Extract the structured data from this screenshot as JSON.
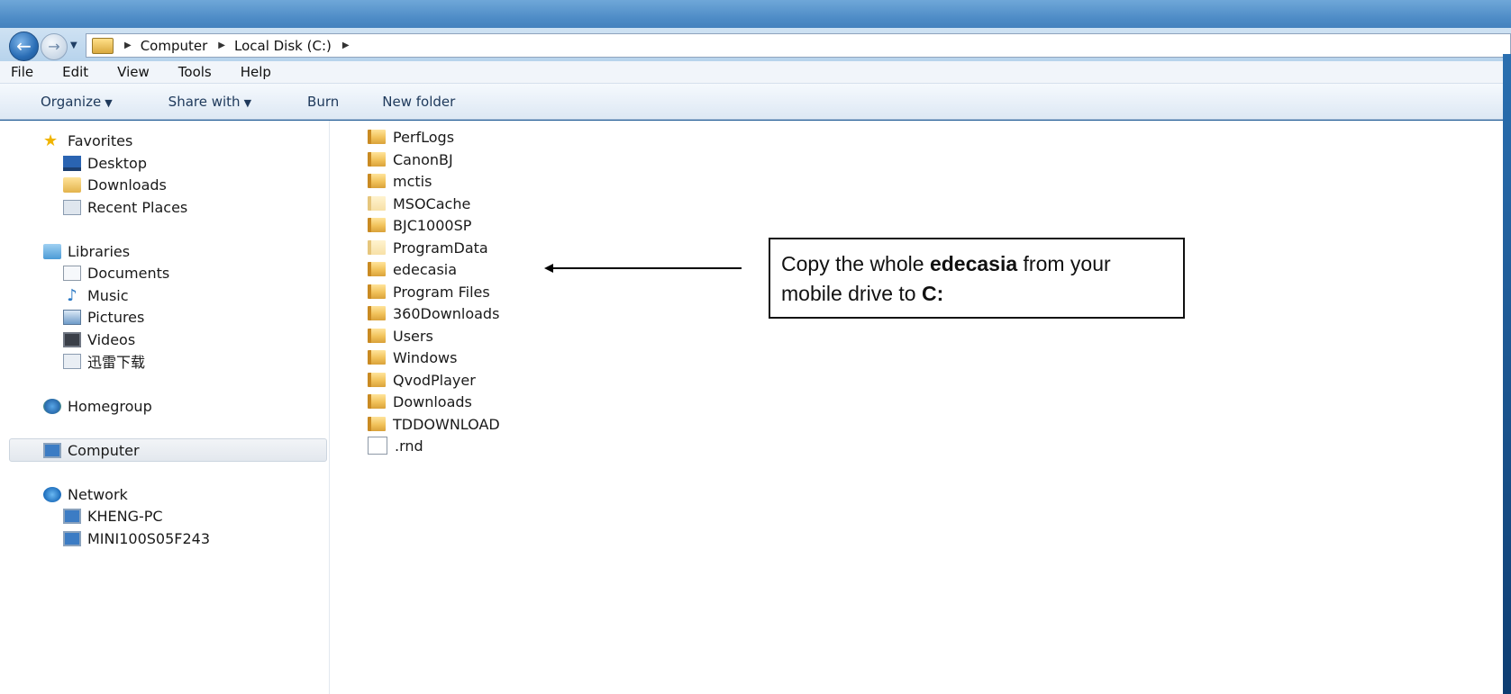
{
  "address_bar": {
    "crumbs": [
      "Computer",
      "Local Disk (C:)"
    ]
  },
  "menu": [
    "File",
    "Edit",
    "View",
    "Tools",
    "Help"
  ],
  "toolbar": {
    "organize": "Organize",
    "share_with": "Share with",
    "burn": "Burn",
    "new_folder": "New folder"
  },
  "nav_pane": {
    "favorites": "Favorites",
    "desktop": "Desktop",
    "downloads": "Downloads",
    "recent_places": "Recent Places",
    "libraries": "Libraries",
    "documents": "Documents",
    "music": "Music",
    "pictures": "Pictures",
    "videos": "Videos",
    "xunlei": "迅雷下载",
    "homegroup": "Homegroup",
    "computer": "Computer",
    "network": "Network",
    "kheng_pc": "KHENG-PC",
    "mini": "MINI100S05F243"
  },
  "files": [
    {
      "name": "PerfLogs"
    },
    {
      "name": "CanonBJ"
    },
    {
      "name": "mctis"
    },
    {
      "name": "MSOCache"
    },
    {
      "name": "BJC1000SP"
    },
    {
      "name": "ProgramData"
    },
    {
      "name": "edecasia"
    },
    {
      "name": "Program Files"
    },
    {
      "name": "360Downloads"
    },
    {
      "name": "Users"
    },
    {
      "name": "Windows"
    },
    {
      "name": "QvodPlayer"
    },
    {
      "name": "Downloads"
    },
    {
      "name": "TDDOWNLOAD"
    },
    {
      "name": ".rnd"
    }
  ],
  "callout": {
    "part1": "Copy the whole ",
    "bold1": "edecasia",
    "part2": " from your mobile drive to ",
    "bold2": "C:"
  }
}
